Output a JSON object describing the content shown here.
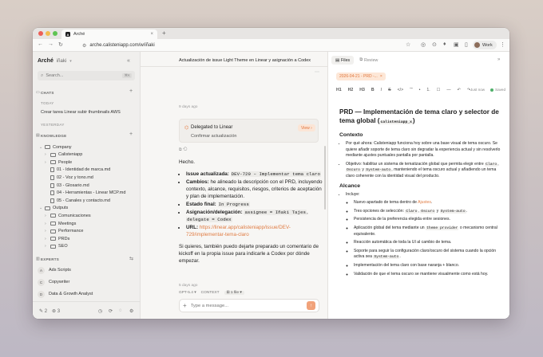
{
  "browser": {
    "tab_title": "Arché",
    "favicon_letter": "A",
    "url": "arche.calisteniapp.com/w/iñaki",
    "profile_label": "Work"
  },
  "sidebar": {
    "brand": "Arché",
    "workspace": "iñaki",
    "search_placeholder": "Search...",
    "search_shortcut": "⌘K",
    "chats_title": "CHATS",
    "today_label": "TODAY",
    "today_chat": "Crear tarea Linear subir thumbnails AWS",
    "yesterday_label": "YESTERDAY",
    "knowledge_title": "KNOWLEDGE",
    "tree": [
      {
        "label": "Company",
        "type": "folder",
        "depth": 0,
        "expanded": true
      },
      {
        "label": "Calisteniapp",
        "type": "folder",
        "depth": 1,
        "expanded": false
      },
      {
        "label": "People",
        "type": "folder",
        "depth": 1,
        "expanded": false
      },
      {
        "label": "01 - Identidad de marca.md",
        "type": "doc",
        "depth": 1
      },
      {
        "label": "02 - Voz y tono.md",
        "type": "doc",
        "depth": 1
      },
      {
        "label": "03 - Glosario.md",
        "type": "doc",
        "depth": 1
      },
      {
        "label": "04 - Herramientas - Linear MCP.md",
        "type": "doc",
        "depth": 1
      },
      {
        "label": "05 - Canales y contacto.md",
        "type": "doc",
        "depth": 1
      },
      {
        "label": "Outputs",
        "type": "folder",
        "depth": 0,
        "expanded": true
      },
      {
        "label": "Comunicaciones",
        "type": "folder",
        "depth": 1,
        "expanded": false
      },
      {
        "label": "Meetings",
        "type": "folder",
        "depth": 1,
        "expanded": false
      },
      {
        "label": "Performance",
        "type": "folder",
        "depth": 1,
        "expanded": false
      },
      {
        "label": "PRDs",
        "type": "folder",
        "depth": 1,
        "expanded": false
      },
      {
        "label": "SEO",
        "type": "folder",
        "depth": 1,
        "expanded": false
      }
    ],
    "experts_title": "EXPERTS",
    "experts": [
      {
        "initial": "A",
        "name": "Ads Scripts"
      },
      {
        "initial": "C",
        "name": "Copywriter"
      },
      {
        "initial": "D",
        "name": "Data & Growth Analyst"
      }
    ],
    "footer": {
      "tasks_count": "2",
      "links_count": "3"
    }
  },
  "chat": {
    "header_title": "Actualización de issue Light Theme en Linear y asignación a Codex",
    "timestamp_1": "9 days ago",
    "delegated_title": "Delegated to Linear",
    "delegated_sub": "Confirmar actualización",
    "view_label": "View",
    "greeting": "Hecho.",
    "b1_label": "Issue actualizada:",
    "b1_code": "DEV-729 – Implementar tema claro",
    "b2_label": "Cambios:",
    "b2_text": "he alineado la descripción con el PRD, incluyendo contexto, alcance, requisitos, riesgos, criterios de aceptación y plan de implementación.",
    "b3_label": "Estado final:",
    "b3_code": "In Progress",
    "b4_label": "Asignación/delegación:",
    "b4_code1": "assignee = Iñaki Tajes",
    "b4_code2": "delegate = Codex",
    "b5_label": "URL:",
    "b5_url": "https://linear.app/calisteniapp/issue/DEV-729/implementar-tema-claro",
    "closing": "Si quieres, también puedo dejarte preparado un comentario de kickoff en la propia issue para indicarle a Codex por dónde empezar.",
    "timestamp_2": "5 days ago",
    "model_label": "GPT-5.4",
    "context_label": "CONTEXT",
    "files_label": "1 file",
    "composer_placeholder": "Type a message..."
  },
  "doc": {
    "tab_files": "Files",
    "tab_review": "Review",
    "file_pill": "2026-04-21 - PRD -...",
    "toolbar": [
      "H1",
      "H2",
      "H3",
      "B",
      "I",
      "S",
      "</>",
      "“”",
      "•",
      "1.",
      "☐",
      "—",
      "↶",
      "↷"
    ],
    "status": "Just now",
    "saved": "Saved",
    "h1_text": "PRD — Implementación de tema claro y selector de tema global (",
    "h1_code": "calisteniapp_x",
    "h1_close": ")",
    "contexto_title": "Contexto",
    "ctx1": "Por qué ahora: Calisteniapp funciona hoy sobre una base visual de tema oscuro. Se quiere añadir soporte de tema claro sin degradar la experiencia actual y sin resolverlo mediante ajustes puntuales pantalla por pantalla.",
    "ctx2_a": "Objetivo: habilitar un sistema de tematización global que permita elegir entre",
    "ctx2_c1": "Claro",
    "ctx2_c2": "Oscuro",
    "ctx2_y": "y",
    "ctx2_c3": "System-auto",
    "ctx2_b": ", manteniendo el tema oscuro actual y añadiendo un tema claro coherente con la identidad visual del producto.",
    "alcance_title": "Alcance",
    "incluye": "Incluye:",
    "inc1_a": "Nuevo apartado de tema dentro de",
    "inc1_link": "Ajustes",
    "inc1_b": ".",
    "inc2_a": "Tres opciones de selección:",
    "inc2_c1": "Claro",
    "inc2_c2": "Oscuro",
    "inc2_y": "y",
    "inc2_c3": "System-auto",
    "inc2_b": ".",
    "inc3": "Persistencia de la preferencia elegida entre sesiones.",
    "inc4_a": "Aplicación global del tema mediante un",
    "inc4_c": "theme provider",
    "inc4_b": "o mecanismo central equivalente.",
    "inc5": "Reacción automática de toda la UI al cambio de tema.",
    "inc6_a": "Soporte para seguir la configuración claro/oscuro del sistema cuando la opción activa sea",
    "inc6_c": "System-auto",
    "inc6_b": ".",
    "inc7": "Implementación del tema claro con base naranja + blanco.",
    "inc8": "Validación de que el tema oscuro se mantiene visualmente como está hoy."
  }
}
